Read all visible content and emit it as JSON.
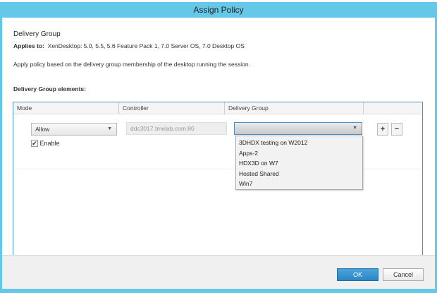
{
  "window": {
    "title": "Assign Policy"
  },
  "header": {
    "title": "Delivery Group",
    "applies_label": "Applies to:",
    "applies_value": "XenDesktop: 5.0, 5.5, 5.6 Feature Pack 1, 7.0 Server OS, 7.0 Desktop OS",
    "description": "Apply policy based on the delivery group membership of the desktop running the session.",
    "elements_label": "Delivery Group elements:"
  },
  "table": {
    "columns": [
      "Mode",
      "Controller",
      "Delivery Group",
      ""
    ],
    "row": {
      "mode": "Allow",
      "controller": "ddc3017.tmelab.com:80",
      "delivery_group": "",
      "enable_label": "Enable",
      "enabled": true,
      "add": "+",
      "remove": "−"
    },
    "dropdown_options": [
      "3DHDX testing on W2012",
      "Apps-2",
      "HDX3D on W7",
      "Hosted Shared",
      "Win7"
    ]
  },
  "footer": {
    "ok": "OK",
    "cancel": "Cancel"
  }
}
